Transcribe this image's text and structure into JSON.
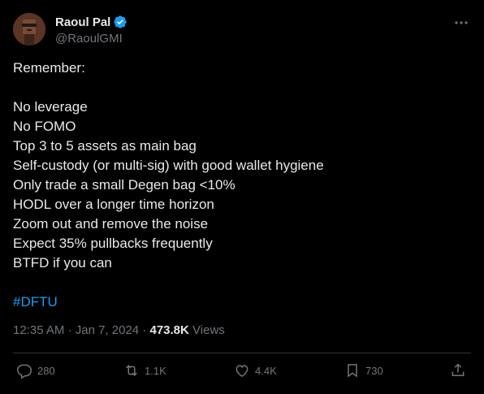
{
  "author": {
    "display_name": "Raoul Pal",
    "handle": "@RaoulGMI",
    "verified": true
  },
  "tweet": {
    "lines": [
      "Remember:",
      "",
      "No leverage",
      "No FOMO",
      "Top 3 to 5 assets as main bag",
      "Self-custody (or multi-sig) with good wallet hygiene",
      "Only trade a small Degen bag <10%",
      "HODL over a longer time horizon",
      "Zoom out and remove the noise",
      "Expect 35% pullbacks frequently",
      "BTFD if you can",
      ""
    ],
    "hashtag": "#DFTU"
  },
  "meta": {
    "time": "12:35 AM",
    "date": "Jan 7, 2024",
    "separator": "·",
    "views_count": "473.8K",
    "views_label": "Views"
  },
  "actions": {
    "replies": "280",
    "retweets": "1.1K",
    "likes": "4.4K",
    "bookmarks": "730"
  },
  "colors": {
    "background": "#000000",
    "text": "#e7e9ea",
    "muted": "#71767b",
    "accent": "#1d9bf0",
    "divider": "#2f3336"
  },
  "icons": {
    "verified": "verified-badge-icon",
    "more": "more-dots-icon",
    "reply": "reply-icon",
    "retweet": "retweet-icon",
    "like": "heart-icon",
    "bookmark": "bookmark-icon",
    "share": "share-icon"
  }
}
